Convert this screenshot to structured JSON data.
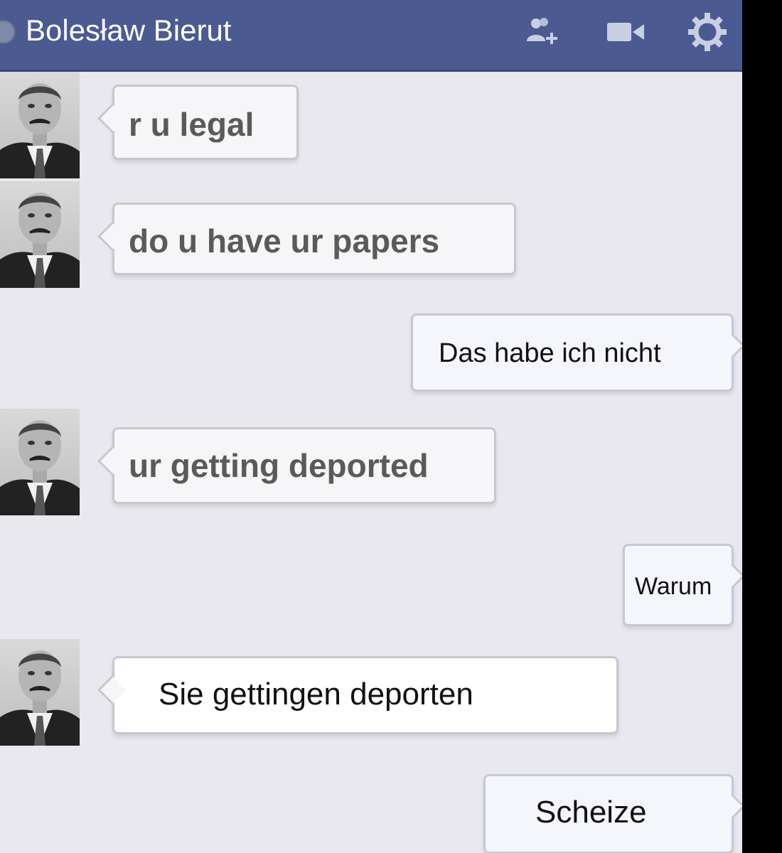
{
  "header": {
    "contact_name": "Bolesław Bierut",
    "icons": [
      "add-friend-icon",
      "video-call-icon",
      "gear-icon"
    ],
    "background": "#4b5a91"
  },
  "messages": [
    {
      "direction": "incoming",
      "text": "r u legal"
    },
    {
      "direction": "incoming",
      "text": "do u have ur papers"
    },
    {
      "direction": "outgoing",
      "text": "Das habe ich nicht"
    },
    {
      "direction": "incoming",
      "text": "ur getting deported"
    },
    {
      "direction": "outgoing",
      "text": "Warum"
    },
    {
      "direction": "incoming",
      "text": "Sie gettingen deporten"
    },
    {
      "direction": "outgoing",
      "text": "Scheize"
    }
  ]
}
